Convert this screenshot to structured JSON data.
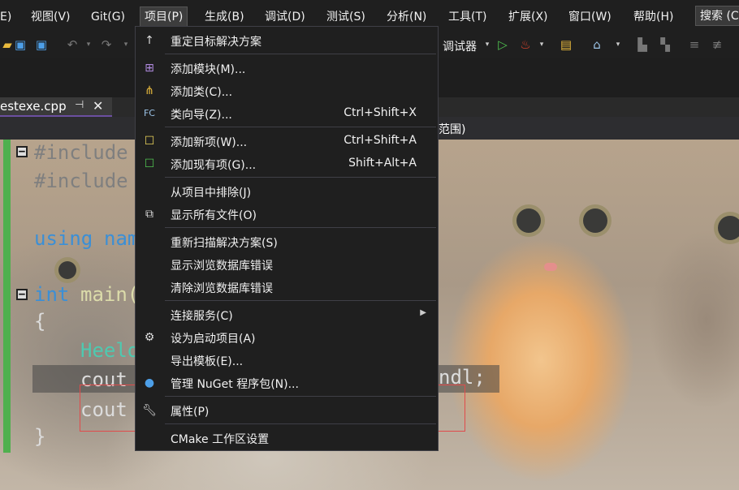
{
  "menubar": {
    "items": [
      "E)",
      "视图(V)",
      "Git(G)",
      "项目(P)",
      "生成(B)",
      "调试(D)",
      "测试(S)",
      "分析(N)",
      "工具(T)",
      "扩展(X)",
      "窗口(W)",
      "帮助(H)"
    ],
    "search_label": "搜索 (C"
  },
  "toolbar": {
    "debugger_label": "调试器"
  },
  "tab": {
    "file_name": "estexe.cpp"
  },
  "editor": {
    "scope_text": "范围)",
    "lines": {
      "l1": "#include",
      "l2": "#include",
      "l3a": "using",
      "l3b": "nam",
      "l4a": "int",
      "l4b": "main(",
      "l5": "{",
      "l6": "Heelo",
      "l7": "cout",
      "l8": "cout",
      "l9": "}",
      "endl": "ndl;"
    }
  },
  "menu": {
    "items": [
      {
        "label": "重定目标解决方案",
        "shortcut": ""
      },
      {
        "label": "添加模块(M)...",
        "shortcut": ""
      },
      {
        "label": "添加类(C)...",
        "shortcut": ""
      },
      {
        "label": "类向导(Z)...",
        "shortcut": "Ctrl+Shift+X"
      },
      {
        "label": "添加新项(W)...",
        "shortcut": "Ctrl+Shift+A"
      },
      {
        "label": "添加现有项(G)...",
        "shortcut": "Shift+Alt+A"
      },
      {
        "label": "从项目中排除(J)",
        "shortcut": ""
      },
      {
        "label": "显示所有文件(O)",
        "shortcut": ""
      },
      {
        "label": "重新扫描解决方案(S)",
        "shortcut": ""
      },
      {
        "label": "显示浏览数据库错误",
        "shortcut": ""
      },
      {
        "label": "清除浏览数据库错误",
        "shortcut": ""
      },
      {
        "label": "连接服务(C)",
        "shortcut": ""
      },
      {
        "label": "设为启动项目(A)",
        "shortcut": ""
      },
      {
        "label": "导出模板(E)...",
        "shortcut": ""
      },
      {
        "label": "管理 NuGet 程序包(N)...",
        "shortcut": ""
      },
      {
        "label": "属性(P)",
        "shortcut": ""
      },
      {
        "label": "CMake 工作区设置",
        "shortcut": ""
      }
    ]
  },
  "colors": {
    "accent": "#6b4fa0",
    "highlight_box": "#e04b4b",
    "menu_bg": "#1f1f1f"
  }
}
